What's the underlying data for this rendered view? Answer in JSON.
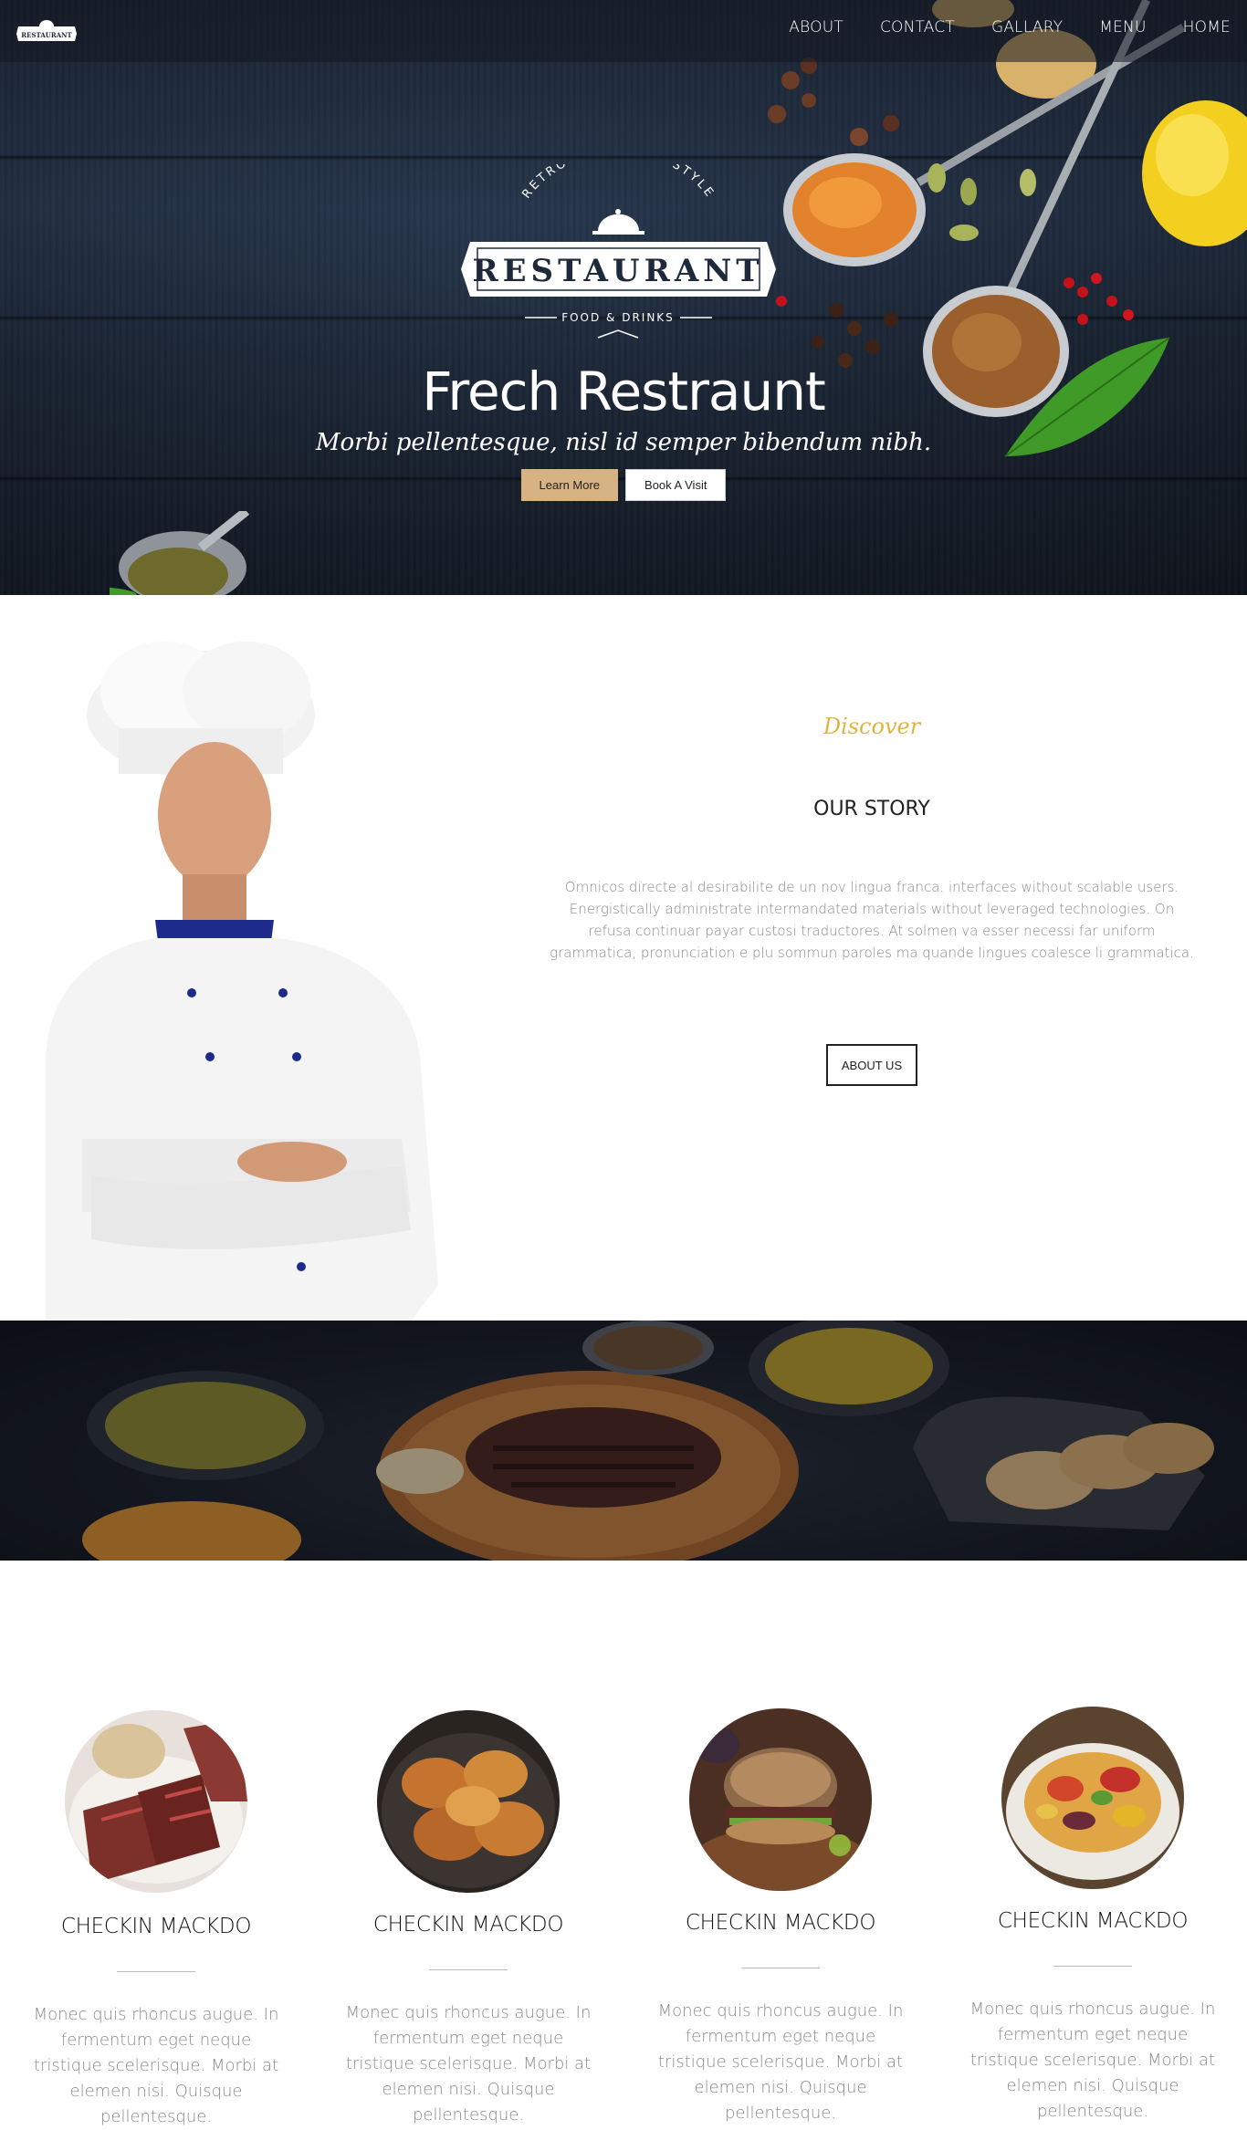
{
  "nav": {
    "logo_text": "RESTAURANT",
    "links": [
      "ABOUT",
      "CONTACT",
      "GALLARY",
      "MENU",
      "HOME"
    ]
  },
  "hero": {
    "emblem_top": "RETRO AUTHENTIC STYLE",
    "emblem_main": "RESTAURANT",
    "emblem_bottom": "FOOD & DRINKS",
    "title": "Frech Restraunt",
    "subtitle": "Morbi pellentesque, nisl id semper bibendum nibh.",
    "learn_more": "Learn More",
    "book_visit": "Book A Visit"
  },
  "story": {
    "discover": "Discover",
    "title": "OUR STORY",
    "text": "Omnicos directe al desirabilite de un nov lingua franca. interfaces without scalable users. Energistically administrate intermandated materials without leveraged technologies. On refusa continuar payar custosi traductores. At solmen va esser necessi far uniform grammatica, pronunciation e plu sommun paroles ma quande lingues coalesce li grammatica.",
    "button": "ABOUT US"
  },
  "dishes": [
    {
      "title": "CHECKIN MACKDO",
      "text": "Monec quis rhoncus augue. In fermentum eget neque tristique scelerisque. Morbi at elemen nisi. Quisque pellentesque."
    },
    {
      "title": "CHECKIN MACKDO",
      "text": "Monec quis rhoncus augue. In fermentum eget neque tristique scelerisque. Morbi at elemen nisi. Quisque pellentesque."
    },
    {
      "title": "CHECKIN MACKDO",
      "text": "Monec quis rhoncus augue. In fermentum eget neque tristique scelerisque. Morbi at elemen nisi. Quisque pellentesque."
    },
    {
      "title": "CHECKIN MACKDO",
      "text": "Monec quis rhoncus augue. In fermentum eget neque tristique scelerisque. Morbi at elemen nisi. Quisque pellentesque."
    }
  ],
  "colors": {
    "accent_gold": "#e2b340",
    "button_tan": "#d7b283",
    "hero_wood": "#1e2a3c"
  }
}
